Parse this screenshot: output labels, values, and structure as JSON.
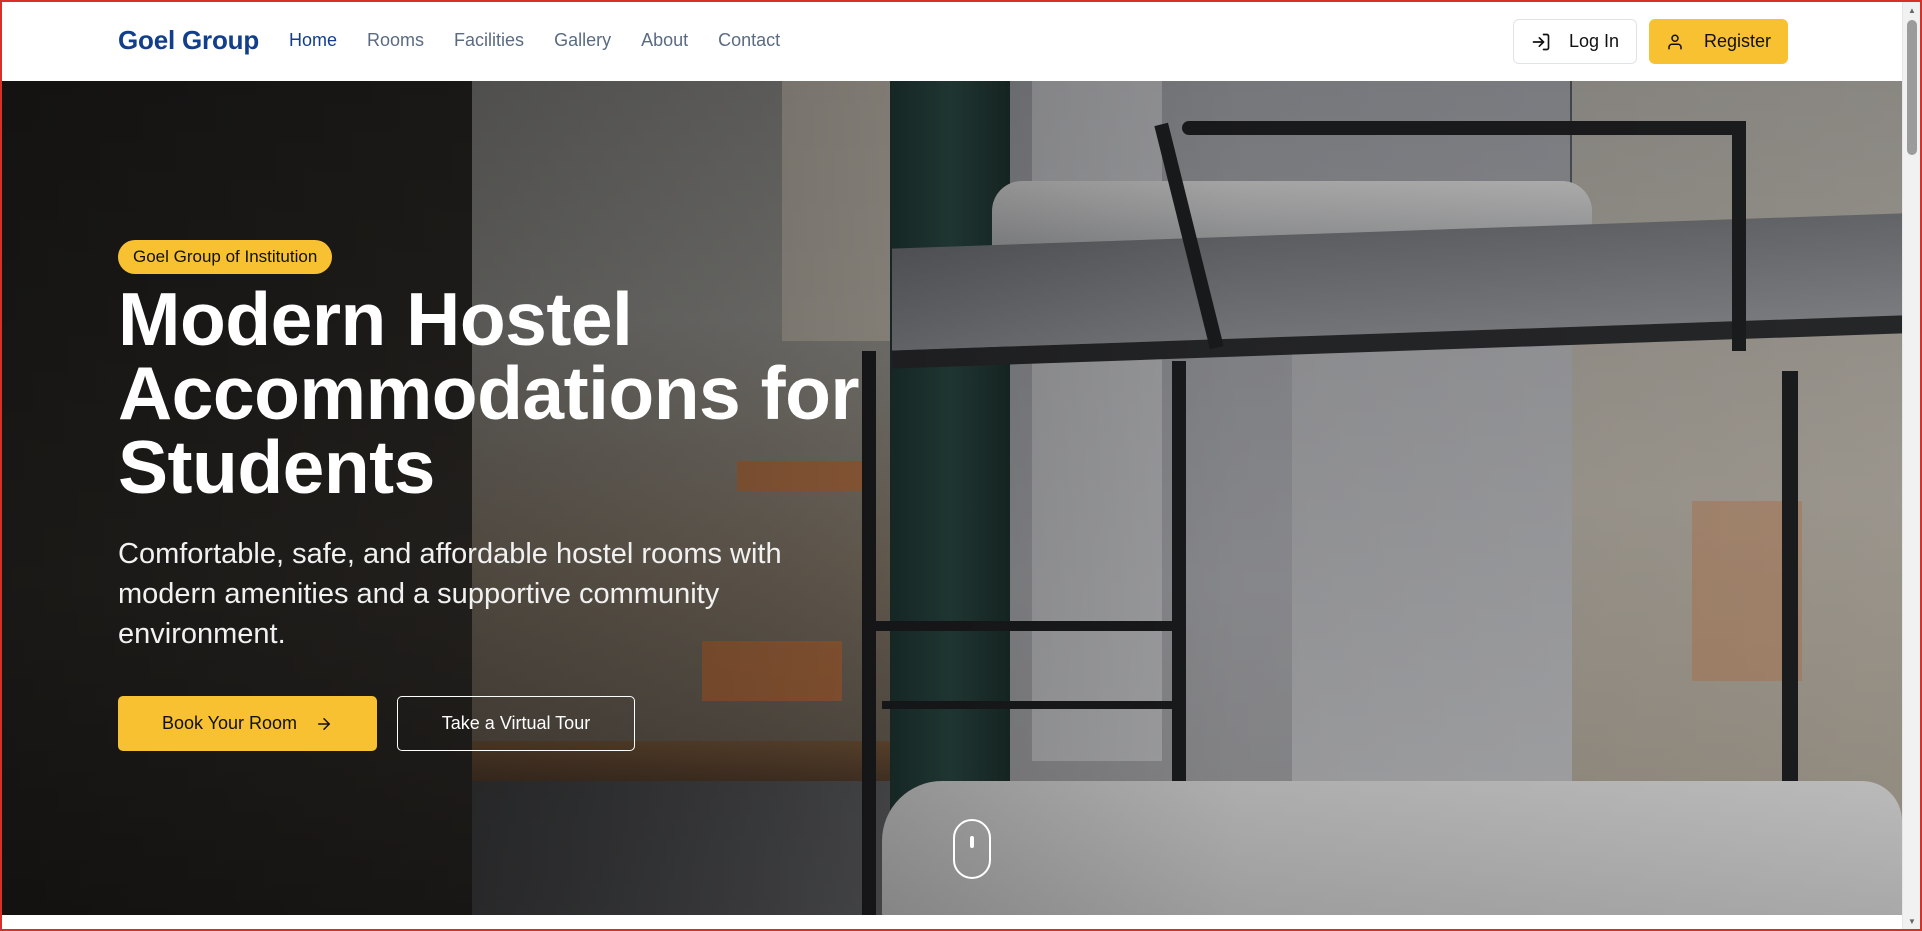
{
  "brand": "Goel Group",
  "nav": {
    "links": [
      {
        "label": "Home",
        "active": true
      },
      {
        "label": "Rooms"
      },
      {
        "label": "Facilities"
      },
      {
        "label": "Gallery"
      },
      {
        "label": "About"
      },
      {
        "label": "Contact"
      }
    ],
    "login_label": "Log In",
    "register_label": "Register"
  },
  "hero": {
    "badge": "Goel Group of Institution",
    "title": "Modern Hostel Accommodations for Students",
    "subtitle": "Comfortable, safe, and affordable hostel rooms with modern amenities and a supportive community environment.",
    "primary_cta": "Book Your Room",
    "secondary_cta": "Take a Virtual Tour"
  },
  "icons": {
    "login": "log-in-icon",
    "register": "user-icon",
    "book": "arrow-right-icon",
    "scroll": "mouse-scroll-icon"
  },
  "colors": {
    "brand": "#123f8c",
    "accent": "#f8c132",
    "nav_text": "#5a6b82"
  }
}
